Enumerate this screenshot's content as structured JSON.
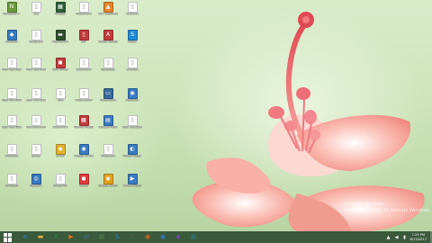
{
  "desktop_icons": [
    {
      "name": "notepad-icon",
      "label": "Notepad++",
      "color": "#6a9a3a",
      "glyph": "N"
    },
    {
      "name": "file-icon",
      "label": "Tutt",
      "color": "#ffffff",
      "glyph": "▯"
    },
    {
      "name": "image-icon",
      "label": "Images",
      "color": "#2d5f3a",
      "glyph": "▦"
    },
    {
      "name": "folder-icon",
      "label": "PowerPoint",
      "color": "#ffffff",
      "glyph": "▯"
    },
    {
      "name": "vlc-icon",
      "label": "VLC media player",
      "color": "#e5852a",
      "glyph": "▲"
    },
    {
      "name": "file-icon",
      "label": "Shortcut",
      "color": "#ffffff",
      "glyph": "▯"
    },
    {
      "name": "shortcut-icon",
      "label": "Shortcut",
      "color": "#3a7ac0",
      "glyph": "◆"
    },
    {
      "name": "file-icon",
      "label": "setup.ext",
      "color": "#ffffff",
      "glyph": "▯"
    },
    {
      "name": "program-icon",
      "label": "Application",
      "color": "#2f4f2f",
      "glyph": "▬"
    },
    {
      "name": "pdf-icon",
      "label": "pdf",
      "color": "#c23b3b",
      "glyph": "▯"
    },
    {
      "name": "pdf-icon",
      "label": "Adobe Reader XI",
      "color": "#c23b3b",
      "glyph": "A"
    },
    {
      "name": "skype-icon",
      "label": "Skype",
      "color": "#1f8ad4",
      "glyph": "S"
    },
    {
      "name": "file-icon",
      "label": "New Text Document",
      "color": "#ffffff",
      "glyph": "▯"
    },
    {
      "name": "file-icon",
      "label": "New Text Document",
      "color": "#ffffff",
      "glyph": "▯"
    },
    {
      "name": "app-icon",
      "label": "Unit Office",
      "color": "#c23b3b",
      "glyph": "◼"
    },
    {
      "name": "file-icon",
      "label": "Document",
      "color": "#ffffff",
      "glyph": "▯"
    },
    {
      "name": "file-icon",
      "label": "Notebook",
      "color": "#ffffff",
      "glyph": "▯"
    },
    {
      "name": "file-icon",
      "label": "Untitled",
      "color": "#ffffff",
      "glyph": "▯"
    },
    {
      "name": "file-icon",
      "label": "New Text Document",
      "color": "#ffffff",
      "glyph": "▯"
    },
    {
      "name": "file-icon",
      "label": "New Text Document",
      "color": "#ffffff",
      "glyph": "▯"
    },
    {
      "name": "file-icon",
      "label": "Text",
      "color": "#ffffff",
      "glyph": "▯"
    },
    {
      "name": "file-icon",
      "label": "Video Editor",
      "color": "#ffffff",
      "glyph": "▯"
    },
    {
      "name": "screen-icon",
      "label": "Screenshot",
      "color": "#3a6a9a",
      "glyph": "▭"
    },
    {
      "name": "app-icon",
      "label": "Recorder",
      "color": "#3a7ac0",
      "glyph": "◉"
    },
    {
      "name": "file-icon",
      "label": "New Text Document",
      "color": "#ffffff",
      "glyph": "▯"
    },
    {
      "name": "file-icon",
      "label": "Text Document",
      "color": "#ffffff",
      "glyph": "▯"
    },
    {
      "name": "file-icon",
      "label": "Document",
      "color": "#ffffff",
      "glyph": "▯"
    },
    {
      "name": "app-icon",
      "label": "Format Factory",
      "color": "#c23b3b",
      "glyph": "▦"
    },
    {
      "name": "app-icon",
      "label": "Control Panel",
      "color": "#3a7ac0",
      "glyph": "▤"
    },
    {
      "name": "file-icon",
      "label": "New Text Document",
      "color": "#ffffff",
      "glyph": "▯"
    },
    {
      "name": "file-icon",
      "label": "Windows",
      "color": "#ffffff",
      "glyph": "▯"
    },
    {
      "name": "file-icon",
      "label": "Setup",
      "color": "#ffffff",
      "glyph": "▯"
    },
    {
      "name": "app-icon",
      "label": "Aviutl",
      "color": "#e0b030",
      "glyph": "◆"
    },
    {
      "name": "app-icon",
      "label": "Google Chrome",
      "color": "#3a7ac0",
      "glyph": "◉"
    },
    {
      "name": "file-icon",
      "label": "Snapshot",
      "color": "#ffffff",
      "glyph": "▯"
    },
    {
      "name": "app-icon",
      "label": "Media Player",
      "color": "#3a7ac0",
      "glyph": "◐"
    },
    {
      "name": "file-icon",
      "label": "Uninstall",
      "color": "#ffffff",
      "glyph": "▯"
    },
    {
      "name": "network-icon",
      "label": "Network",
      "color": "#3a7ac0",
      "glyph": "◎"
    },
    {
      "name": "file-icon",
      "label": "Snapshot",
      "color": "#ffffff",
      "glyph": "▯"
    },
    {
      "name": "app-icon",
      "label": "Teams",
      "color": "#e03a3a",
      "glyph": "◼"
    },
    {
      "name": "chrome-icon",
      "label": "Google Chrome",
      "color": "#e0a020",
      "glyph": "◉"
    },
    {
      "name": "app-icon",
      "label": "Media Player",
      "color": "#3a7ac0",
      "glyph": "▶"
    }
  ],
  "taskbar": {
    "buttons": [
      {
        "name": "ie-icon",
        "glyph": "e",
        "color": "#2a8ad8"
      },
      {
        "name": "file-explorer-icon",
        "glyph": "▬",
        "color": "#e0b040"
      },
      {
        "name": "excel-icon",
        "glyph": "X",
        "color": "#2e8a3e"
      },
      {
        "name": "media-icon",
        "glyph": "▶",
        "color": "#d07020"
      },
      {
        "name": "sync-icon",
        "glyph": "⇄",
        "color": "#3a6aa0"
      },
      {
        "name": "photos-icon",
        "glyph": "▦",
        "color": "#4a7a4a"
      },
      {
        "name": "skype-icon",
        "glyph": "S",
        "color": "#1f8ad4"
      },
      {
        "name": "settings-icon",
        "glyph": "⚙",
        "color": "#506050"
      },
      {
        "name": "firefox-icon",
        "glyph": "◉",
        "color": "#e06020"
      },
      {
        "name": "chrome-icon",
        "glyph": "◉",
        "color": "#3a7ac0"
      },
      {
        "name": "app-icon",
        "glyph": "◆",
        "color": "#6a4a9a"
      },
      {
        "name": "app-icon",
        "glyph": "▦",
        "color": "#2a7a8a"
      }
    ],
    "tray": {
      "clock_time": "7:29 PM",
      "clock_date": "8/13/2017"
    }
  },
  "watermark": {
    "line1": "Activate Windows",
    "line2": "Go to PC settings to activate Windows."
  }
}
